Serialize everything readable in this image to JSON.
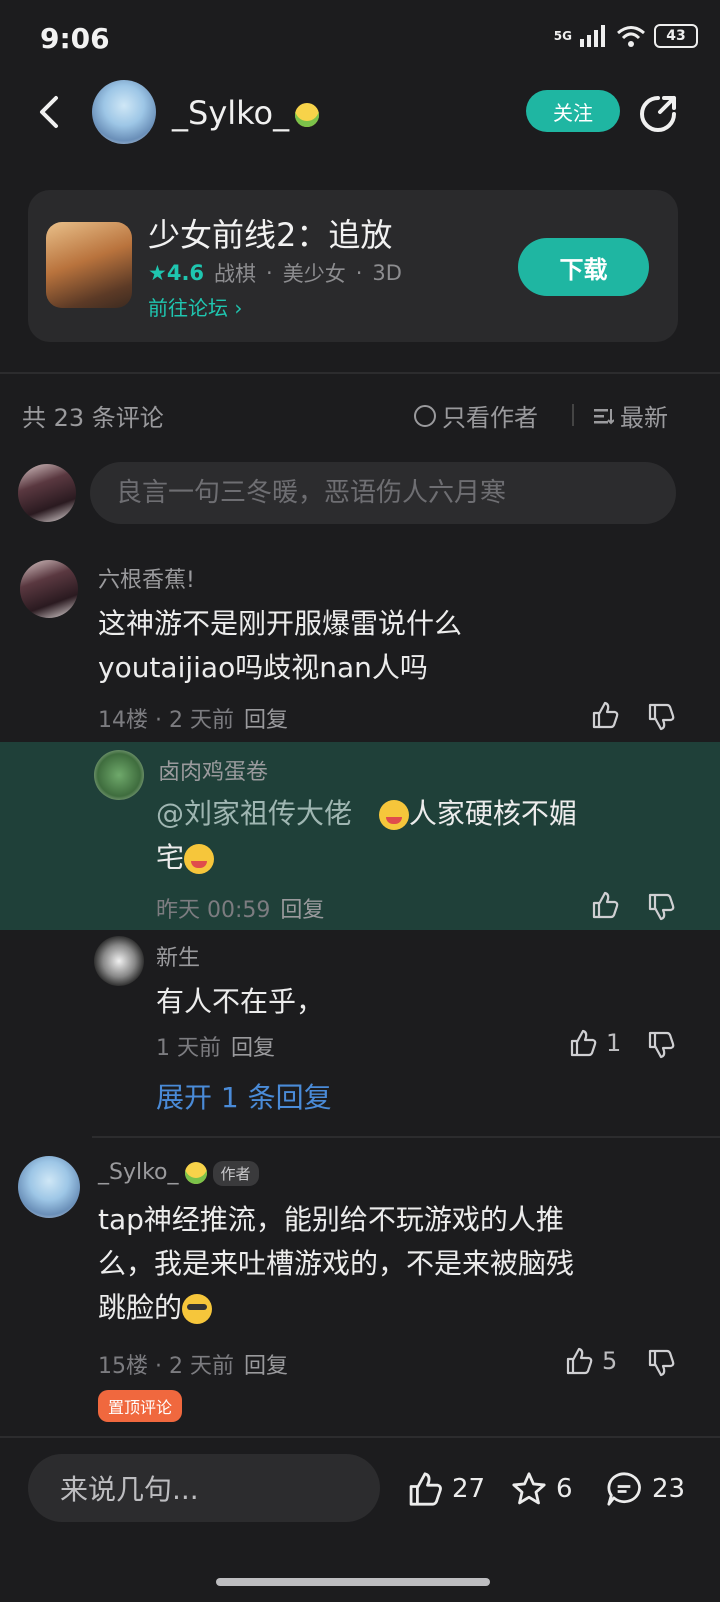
{
  "status": {
    "time": "9:06",
    "network": "5G",
    "battery": "43"
  },
  "header": {
    "username": "_Sylko_",
    "follow_label": "关注"
  },
  "game": {
    "title": "少女前线2：追放",
    "rating": "4.6",
    "tags": [
      "战棋",
      "美少女",
      "3D"
    ],
    "forum_link": "前往论坛 ›",
    "download_label": "下载"
  },
  "comments_header": {
    "count": "共 23 条评论",
    "only_author": "只看作者",
    "sort": "最新"
  },
  "input": {
    "placeholder": "良言一句三冬暖，恶语伤人六月寒"
  },
  "comments": [
    {
      "name": "六根香蕉!",
      "body_line1": "这神游不是刚开服爆雷说什么",
      "body_line2": "youtaijiao吗歧视nan人吗",
      "floor": "14楼",
      "time": "2 天前",
      "reply": "回复"
    }
  ],
  "replies": [
    {
      "name": "卤肉鸡蛋卷",
      "body_line1_mention": "@刘家祖传大佬",
      "body_line1_text": "人家硬核不媚",
      "body_line2": "宅",
      "time": "昨天 00:59",
      "reply": "回复"
    },
    {
      "name": "新生",
      "body": "有人不在乎，",
      "time": "1 天前",
      "reply": "回复",
      "likes": "1"
    }
  ],
  "expand_label": "展开 1 条回复",
  "author_comment": {
    "name": "_Sylko_",
    "author_tag": "作者",
    "body_line1": "tap神经推流，能别给不玩游戏的人推",
    "body_line2": "么，我是来吐槽游戏的，不是来被脑残",
    "body_line3": "跳脸的",
    "floor": "15楼",
    "time": "2 天前",
    "reply": "回复",
    "likes": "5",
    "pin_tag": "置顶评论"
  },
  "bottom": {
    "input_label": "来说几句...",
    "likes": "27",
    "favorites": "6",
    "comments": "23"
  },
  "colors": {
    "accent": "#1fb6a2",
    "highlight_bg": "#1f4039",
    "link_blue": "#4a8bd8",
    "pin": "#f0683e"
  }
}
